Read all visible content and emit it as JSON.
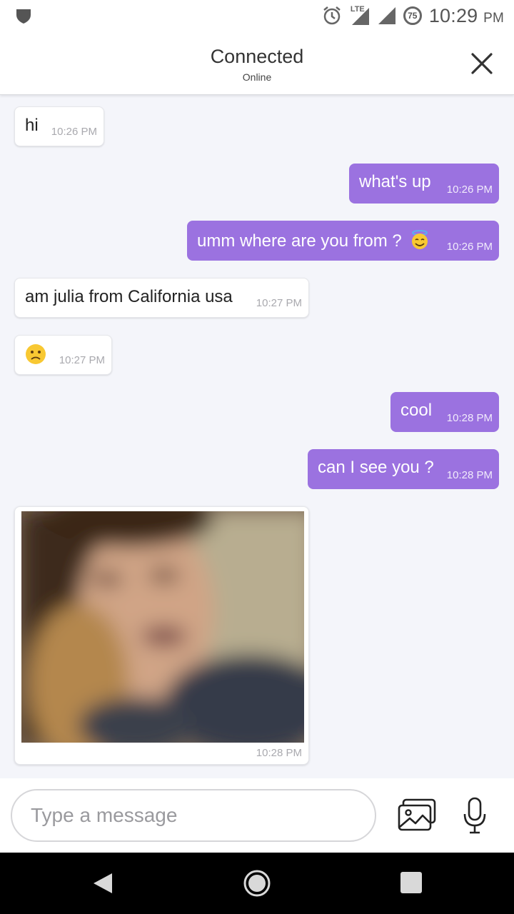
{
  "status_bar": {
    "time": "10:29",
    "ampm": "PM",
    "network": "LTE",
    "battery": "75"
  },
  "header": {
    "title": "Connected",
    "subtitle": "Online"
  },
  "messages": [
    {
      "text": "hi",
      "time": "10:26 PM"
    },
    {
      "text": "what's up",
      "time": "10:26 PM"
    },
    {
      "text": "umm where are you from ?",
      "time": "10:26 PM"
    },
    {
      "text": "am julia from California usa",
      "time": "10:27 PM"
    },
    {
      "text": "",
      "time": "10:27 PM"
    },
    {
      "text": "cool",
      "time": "10:28 PM"
    },
    {
      "text": "can I see you ?",
      "time": "10:28 PM"
    },
    {
      "text": "",
      "time": "10:28 PM"
    }
  ],
  "input": {
    "placeholder": "Type a message"
  },
  "icons": {
    "shield": "shield-icon",
    "alarm": "alarm-icon",
    "signal": "signal-icon",
    "close": "close-icon",
    "gallery": "gallery-icon",
    "mic": "microphone-icon",
    "back": "back-icon",
    "home": "home-icon",
    "recent": "recent-apps-icon"
  },
  "colors": {
    "outgoing": "#9b72e0",
    "incoming": "#ffffff",
    "background": "#f4f5fa"
  }
}
